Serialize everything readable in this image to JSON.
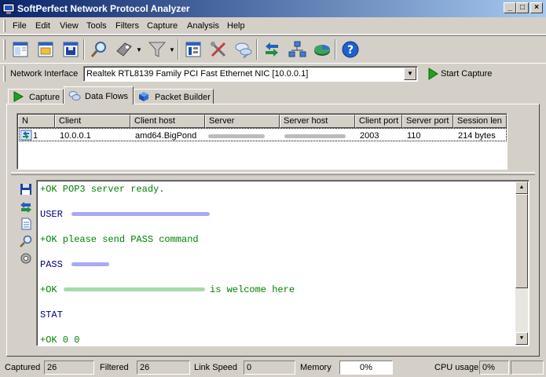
{
  "window": {
    "title": "SoftPerfect Network Protocol Analyzer",
    "min_glyph": "_",
    "max_glyph": "□",
    "close_glyph": "×"
  },
  "menu": [
    "File",
    "Edit",
    "View",
    "Tools",
    "Filters",
    "Capture",
    "Analysis",
    "Help"
  ],
  "interface": {
    "label": "Network Interface",
    "value": "Realtek RTL8139 Family PCI Fast Ethernet NIC [10.0.0.1]",
    "start_capture_label": "Start Capture"
  },
  "tabs": [
    {
      "label": "Capture",
      "active": false
    },
    {
      "label": "Data Flows",
      "active": true
    },
    {
      "label": "Packet Builder",
      "active": false
    }
  ],
  "flows": {
    "columns": [
      "N",
      "Client",
      "Client host",
      "Server",
      "Server host",
      "Client port",
      "Server port",
      "Session len"
    ],
    "rows": [
      {
        "n": "1",
        "client": "10.0.0.1",
        "client_host": "amd64.BigPond",
        "client_port": "2003",
        "server_port": "110",
        "session_len": "214 bytes"
      }
    ]
  },
  "session": {
    "lines": [
      {
        "text": "+OK POP3 server ready.",
        "color": "green"
      },
      {
        "text": "USER",
        "color": "blue"
      },
      {
        "text": "+OK please send PASS command",
        "color": "green"
      },
      {
        "text": "PASS",
        "color": "blue"
      },
      {
        "text": "+OK",
        "suffix": "is welcome here",
        "color": "green"
      },
      {
        "text": "STAT",
        "color": "blue"
      },
      {
        "text": "+OK 0 0",
        "color": "green"
      }
    ]
  },
  "status": {
    "captured_label": "Captured",
    "captured_value": "26",
    "filtered_label": "Filtered",
    "filtered_value": "26",
    "link_speed_label": "Link Speed",
    "link_speed_value": "0",
    "memory_label": "Memory",
    "memory_value": "0%",
    "cpu_label": "CPU usage",
    "cpu_value": "0%"
  },
  "colors": {
    "title_start": "#0a246a",
    "title_end": "#a6caf0",
    "server_text": "#008000",
    "client_text": "#000080",
    "redaction_blue": "#7070f0",
    "redaction_green": "#70c070",
    "redaction_gray": "#a0a0a0"
  }
}
